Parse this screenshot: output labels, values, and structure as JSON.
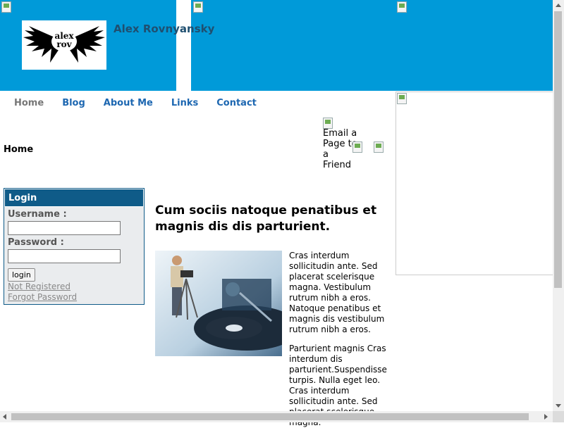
{
  "header": {
    "site_title": "Alex Rovnyansky",
    "logo_text": "alex rov"
  },
  "nav": {
    "items": [
      {
        "label": "Home"
      },
      {
        "label": "Blog"
      },
      {
        "label": "About Me"
      },
      {
        "label": "Links"
      },
      {
        "label": "Contact"
      }
    ]
  },
  "breadcrumb": "Home",
  "share": {
    "email_alt": "Email a Page to a Friend"
  },
  "login": {
    "title": "Login",
    "username_label": "Username :",
    "password_label": "Password :",
    "button": "login",
    "not_registered": "Not Registered",
    "forgot_password": "Forgot Password"
  },
  "article": {
    "title": "Cum sociis natoque penatibus et magnis dis dis parturient.",
    "p1": "Cras interdum sollicitudin ante. Sed placerat scelerisque magna. Vestibulum rutrum nibh a eros. Natoque penatibus et magnis dis vestibulum rutrum nibh a eros.",
    "p2": "Parturient magnis Cras interdum dis parturient.Suspendisse turpis. Nulla eget leo. Cras interdum sollicitudin ante. Sed placerat scelerisque magna."
  },
  "colors": {
    "header_blue": "#009ad9",
    "nav_link": "#1d67b1",
    "login_head": "#0f5b88"
  }
}
